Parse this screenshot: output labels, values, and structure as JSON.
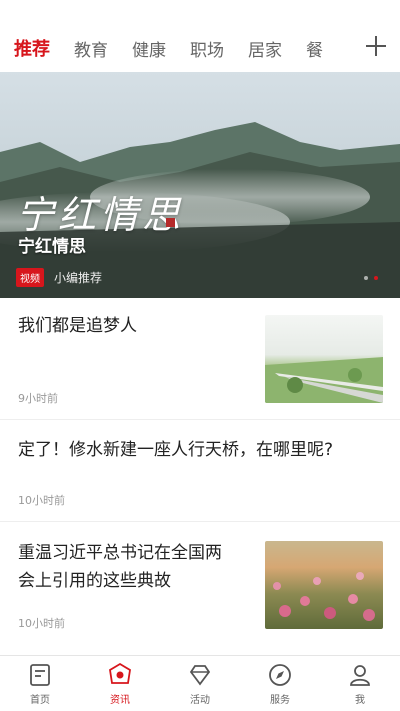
{
  "tabs": [
    {
      "label": "推荐",
      "active": true
    },
    {
      "label": "教育",
      "active": false
    },
    {
      "label": "健康",
      "active": false
    },
    {
      "label": "职场",
      "active": false
    },
    {
      "label": "居家",
      "active": false
    },
    {
      "label": "餐",
      "active": false
    }
  ],
  "banner": {
    "calligraphy": "宁红情思",
    "title": "宁红情思",
    "badge": "视频",
    "subtitle": "小编推荐"
  },
  "news": [
    {
      "title": "我们都是追梦人",
      "time": "9小时前",
      "has_thumb": true
    },
    {
      "title": "定了！修水新建一座人行天桥，在哪里呢?",
      "time": "10小时前",
      "has_thumb": false
    },
    {
      "title_line1": "重温习近平总书记在全国两",
      "title_line2": "会上引用的这些典故",
      "time": "10小时前",
      "has_thumb": true
    }
  ],
  "bottom_nav": [
    {
      "label": "首页",
      "icon": "home-icon",
      "active": false
    },
    {
      "label": "资讯",
      "icon": "news-icon",
      "active": true
    },
    {
      "label": "活动",
      "icon": "diamond-icon",
      "active": false
    },
    {
      "label": "服务",
      "icon": "compass-icon",
      "active": false
    },
    {
      "label": "我",
      "icon": "user-icon",
      "active": false
    }
  ],
  "colors": {
    "accent": "#d7161c",
    "text": "#222222",
    "muted": "#999999"
  }
}
